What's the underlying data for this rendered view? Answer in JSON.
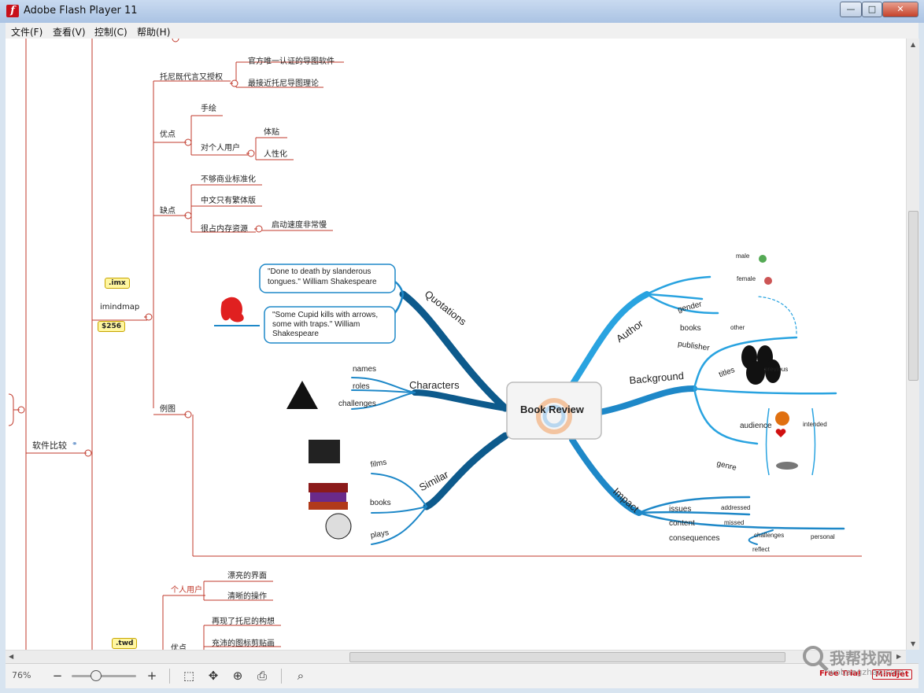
{
  "window": {
    "title": "Adobe Flash Player 11",
    "min": "—",
    "max": "□",
    "close": "✕"
  },
  "menu": [
    "文件(F)",
    "查看(V)",
    "控制(C)",
    "帮助(H)"
  ],
  "tree": {
    "root": "软件比较",
    "branch": "imindmap",
    "tag_top": ".imx",
    "tag_price": "$256",
    "tag_twd": ".twd",
    "n1": "托尼既代言又授权",
    "n1a": "官方唯一认证的导图软件",
    "n1b": "最接近托尼导图理论",
    "n2": "优点",
    "n2a": "手绘",
    "n2b": "对个人用户",
    "n2b1": "体贴",
    "n2b2": "人性化",
    "n3": "缺点",
    "n3a": "不够商业标准化",
    "n3b": "中文只有繁体版",
    "n3c": "很占内存资源",
    "n3c1": "启动速度非常慢",
    "n4": "例图",
    "m1": "个人用户",
    "m1a": "漂亮的界面",
    "m1b": "清晰的操作",
    "m2": "优点",
    "m2a": "再现了托尼的构想",
    "m2b": "充沛的图标剪贴画"
  },
  "example": {
    "center": "Book Review",
    "quotations": "Quotations",
    "quote1": [
      "\"Done to death by slanderous",
      "tongues.\" William Shakespeare"
    ],
    "quote2": [
      "\"Some Cupid kills with arrows,",
      "some with traps.\" William",
      "Shakespeare"
    ],
    "characters": "Characters",
    "char_items": [
      "names",
      "roles",
      "challenges"
    ],
    "similar": "Similar",
    "sim_items": [
      "films",
      "books",
      "plays"
    ],
    "author": "Author",
    "author_items": [
      "gender",
      "books",
      "publisher"
    ],
    "gender_items": [
      "male",
      "female",
      "other"
    ],
    "background": "Background",
    "bg_items": [
      "titles",
      "previous",
      "audience",
      "intended",
      "genre"
    ],
    "impact": "Impact",
    "impact_items": [
      "issues",
      "addressed",
      "content",
      "missed",
      "consequences",
      "challenges",
      "personal",
      "reflect"
    ]
  },
  "toolbar": {
    "zoom": "76%",
    "minus": "−",
    "plus": "+",
    "free_trial": "Free Trial",
    "mindjet": "Mindjet"
  },
  "watermark": {
    "text": "我帮找网",
    "url": "wobangzhao.com"
  },
  "colors": {
    "branch_line": "#c0392b",
    "map_blue": "#1e88c8",
    "map_dark": "#0d5a8c"
  }
}
